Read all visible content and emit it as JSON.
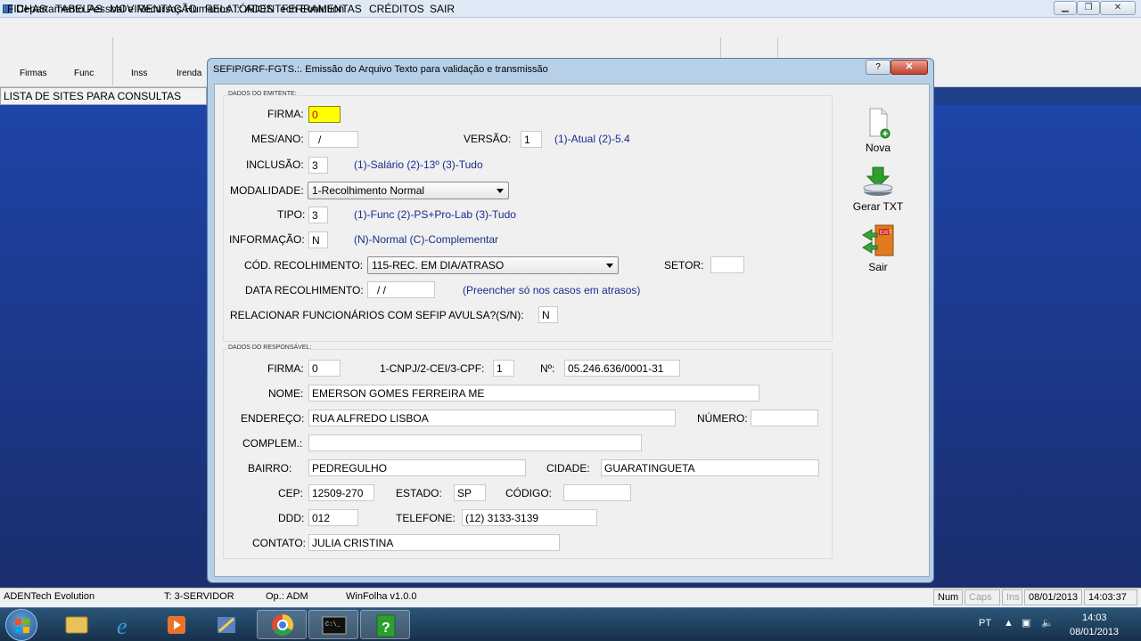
{
  "app": {
    "title": "Departamento Pessoal e Recursos Humanos ::: ADENTech Evolution"
  },
  "menu": [
    "FICHAS",
    "TABELAS",
    "MOVIMENTAÇÃO",
    "RELATÓRIOS",
    "FERRAMENTAS",
    "CRÉDITOS",
    "SAIR"
  ],
  "toolbar": [
    "Firmas",
    "Func",
    "Inss",
    "Irenda"
  ],
  "sites_label": "LISTA DE SITES PARA CONSULTAS",
  "dialog": {
    "title": "SEFIP/GRF-FGTS.:. Emissão do Arquivo Texto para validação e transmissão",
    "help": "?",
    "close": "✕"
  },
  "emitente": {
    "group": "DADOS DO EMITENTE:",
    "firma_label": "FIRMA:",
    "firma_value": "0",
    "mesano_label": "MES/ANO:",
    "mesano_value": "/",
    "versao_label": "VERSÃO:",
    "versao_value": "1",
    "versao_hint": "(1)-Atual   (2)-5.4",
    "inclusao_label": "INCLUSÃO:",
    "inclusao_value": "3",
    "inclusao_hint": "(1)-Salário   (2)-13º   (3)-Tudo",
    "modalidade_label": "MODALIDADE:",
    "modalidade_value": "1-Recolhimento Normal",
    "tipo_label": "TIPO:",
    "tipo_value": "3",
    "tipo_hint": "(1)-Func  (2)-PS+Pro-Lab  (3)-Tudo",
    "informacao_label": "INFORMAÇÃO:",
    "informacao_value": "N",
    "informacao_hint": "(N)-Normal  (C)-Complementar",
    "codrec_label": "CÓD. RECOLHIMENTO:",
    "codrec_value": "115-REC. EM DIA/ATRASO",
    "setor_label": "SETOR:",
    "setor_value": "",
    "datarec_label": "DATA RECOLHIMENTO:",
    "datarec_value": "/ /",
    "datarec_hint": "(Preencher só nos casos em atrasos)",
    "relacionar_label": "RELACIONAR FUNCIONÁRIOS COM SEFIP AVULSA?(S/N):",
    "relacionar_value": "N"
  },
  "responsavel": {
    "group": "DADOS DO RESPONSÁVEL:",
    "firma_label": "FIRMA:",
    "firma_value": "0",
    "cnpj_label": "1-CNPJ/2-CEI/3-CPF:",
    "cnpj_value": "1",
    "numero_doc_label": "Nº:",
    "numero_doc_value": "05.246.636/0001-31",
    "nome_label": "NOME:",
    "nome_value": "EMERSON GOMES FERREIRA ME",
    "endereco_label": "ENDEREÇO:",
    "endereco_value": "RUA ALFREDO LISBOA",
    "numero_label": "NÚMERO:",
    "numero_value": "",
    "complem_label": "COMPLEM.:",
    "complem_value": "",
    "bairro_label": "BAIRRO:",
    "bairro_value": "PEDREGULHO",
    "cidade_label": "CIDADE:",
    "cidade_value": "GUARATINGUETA",
    "cep_label": "CEP:",
    "cep_value": "12509-270",
    "estado_label": "ESTADO:",
    "estado_value": "SP",
    "codigo_label": "CÓDIGO:",
    "codigo_value": "",
    "ddd_label": "DDD:",
    "ddd_value": "012",
    "telefone_label": "TELEFONE:",
    "telefone_value": "(12) 3133-3139",
    "contato_label": "CONTATO:",
    "contato_value": "JULIA CRISTINA"
  },
  "actions": {
    "nova": "Nova",
    "gerar": "Gerar TXT",
    "sair": "Sair"
  },
  "status": {
    "app": "ADENTech Evolution",
    "terminal": "T: 3-SERVIDOR",
    "operator": "Op.: ADM",
    "version": "WinFolha v1.0.0",
    "num": "Num",
    "caps": "Caps",
    "ins": "Ins",
    "date": "08/01/2013",
    "time": "14:03:37"
  },
  "tray": {
    "lang": "PT",
    "time": "14:03",
    "date": "08/01/2013"
  },
  "colors": {
    "accent": "#1a2b8f",
    "highlight": "#ffff00",
    "desktop": "#1f3f8a"
  }
}
